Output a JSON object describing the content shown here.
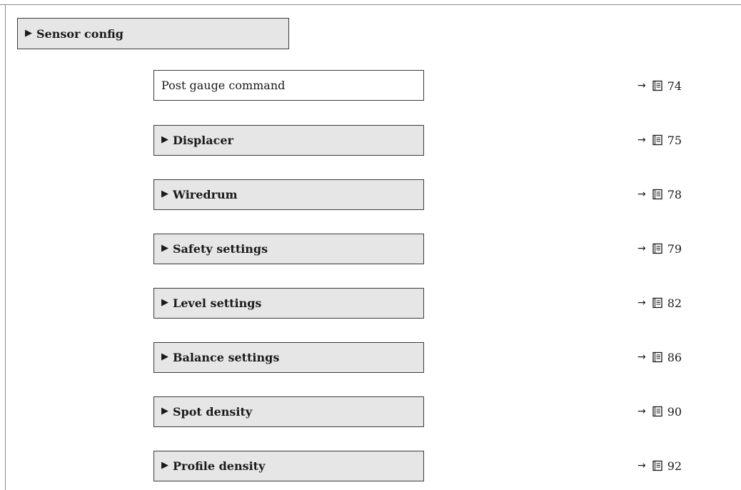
{
  "header": {
    "label": "Sensor config"
  },
  "items": [
    {
      "label": "Post gauge command",
      "page": "74",
      "type": "parameter"
    },
    {
      "label": "Displacer",
      "page": "75",
      "type": "submenu"
    },
    {
      "label": "Wiredrum",
      "page": "78",
      "type": "submenu"
    },
    {
      "label": "Safety settings",
      "page": "79",
      "type": "submenu"
    },
    {
      "label": "Level settings",
      "page": "82",
      "type": "submenu"
    },
    {
      "label": "Balance settings",
      "page": "86",
      "type": "submenu"
    },
    {
      "label": "Spot density",
      "page": "90",
      "type": "submenu"
    },
    {
      "label": "Profile density",
      "page": "92",
      "type": "submenu"
    }
  ],
  "glyphs": {
    "submenu_marker": "▶",
    "ref_arrow": "→"
  },
  "icons": {
    "page_ref": "book-icon"
  }
}
